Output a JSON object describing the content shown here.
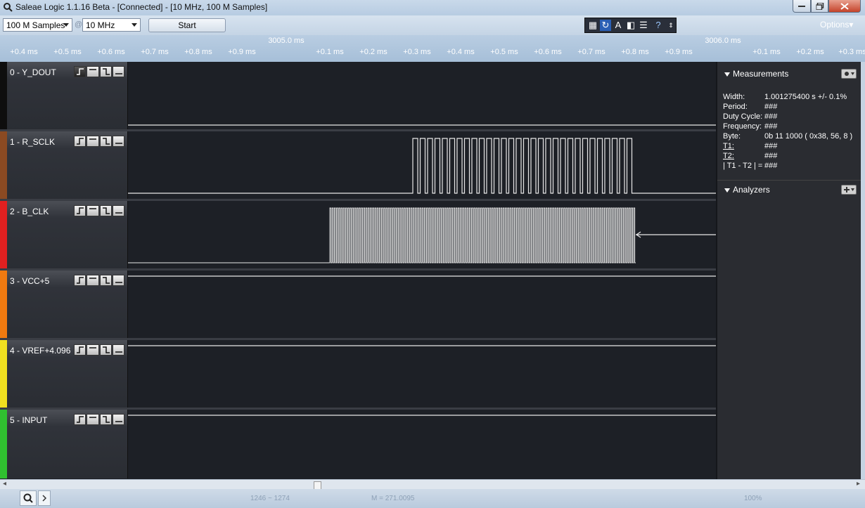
{
  "window": {
    "title": "Saleae Logic 1.1.16 Beta - [Connected] - [10 MHz, 100 M Samples]"
  },
  "toolbar": {
    "samples_value": "100 M Samples",
    "rate_value": "10 MHz",
    "start_label": "Start",
    "options_label": "Options▾",
    "at_symbol": "@"
  },
  "ruler": {
    "major_labels": [
      "3005.0 ms",
      "3006.0 ms"
    ],
    "ticks": [
      "+0.4 ms",
      "+0.5 ms",
      "+0.6 ms",
      "+0.7 ms",
      "+0.8 ms",
      "+0.9 ms",
      "+0.1 ms",
      "+0.2 ms",
      "+0.3 ms",
      "+0.4 ms",
      "+0.5 ms",
      "+0.6 ms",
      "+0.7 ms",
      "+0.8 ms",
      "+0.9 ms",
      "+0.1 ms",
      "+0.2 ms",
      "+0.3 ms"
    ]
  },
  "channels": [
    {
      "name": "0 - Y_DOUT",
      "color": "#111111"
    },
    {
      "name": "1 - R_SCLK",
      "color": "#8b4a22"
    },
    {
      "name": "2 - B_CLK",
      "color": "#e02020"
    },
    {
      "name": "3 - VCC+5",
      "color": "#f07a10"
    },
    {
      "name": "4 - VREF+4.096",
      "color": "#f0e020"
    },
    {
      "name": "5 - INPUT",
      "color": "#30c030"
    }
  ],
  "measurements": {
    "title": "Measurements",
    "rows": [
      {
        "label": "Width:",
        "value": "1.001275400 s +/- 0.1%"
      },
      {
        "label": "Period:",
        "value": "###"
      },
      {
        "label": "Duty Cycle:",
        "value": "###"
      },
      {
        "label": "Frequency:",
        "value": "###"
      },
      {
        "label": "Byte:",
        "value": "0b 11 1000 ( 0x38, 56, 8 )"
      },
      {
        "label": "T1:",
        "value": "###"
      },
      {
        "label": "T2:",
        "value": "###"
      },
      {
        "label": "| T1 - T2 | =",
        "value": "###"
      }
    ]
  },
  "analyzers": {
    "title": "Analyzers"
  },
  "statusbar": {
    "left_text": "1246 ~ 1274",
    "mid_text": "M = 271.0095",
    "right_text": "100%"
  }
}
